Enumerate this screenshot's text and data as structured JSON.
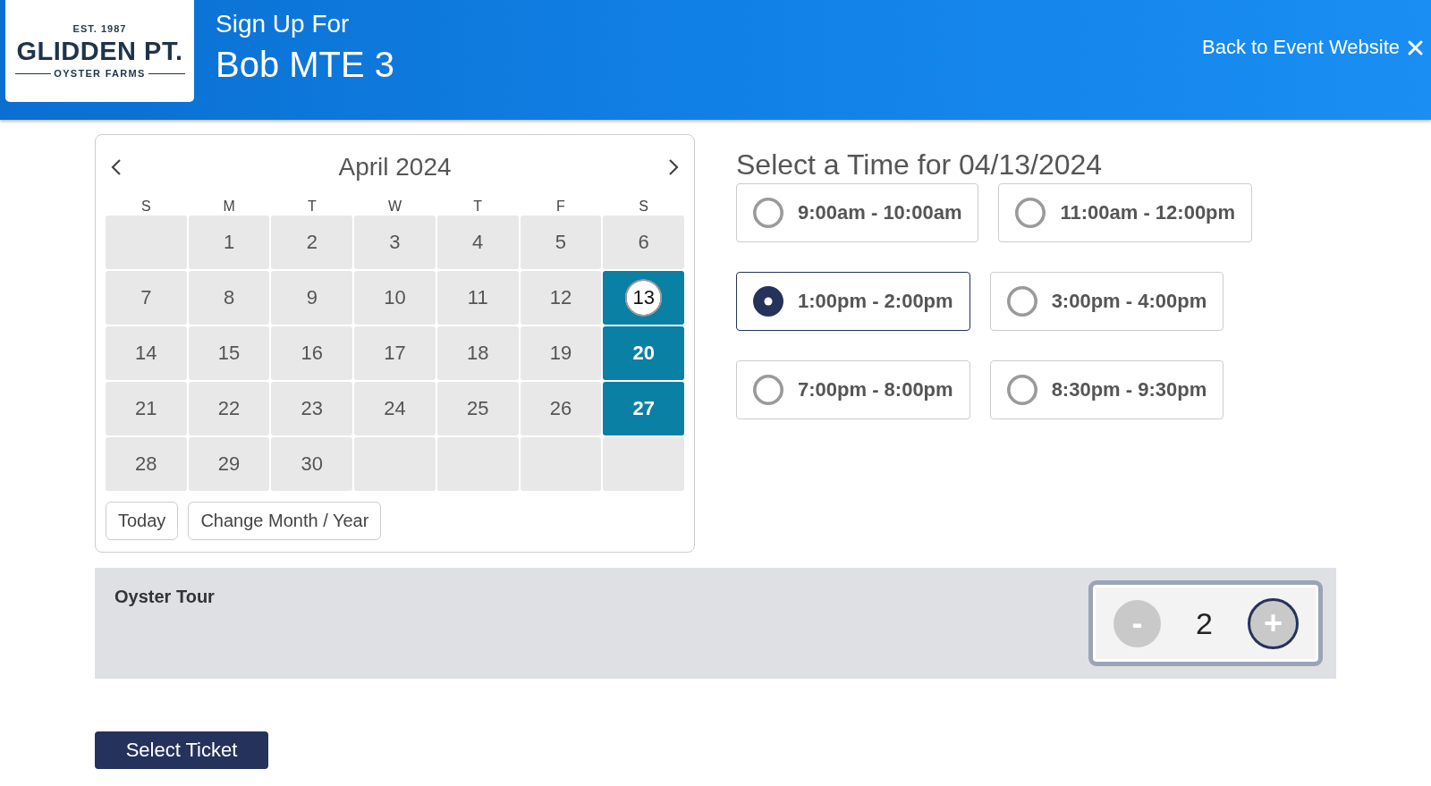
{
  "header": {
    "logo": {
      "established": "EST. 1987",
      "name": "GLIDDEN PT.",
      "tagline": "OYSTER FARMS"
    },
    "subtitle": "Sign Up For",
    "title": "Bob MTE 3",
    "back_link": "Back to Event Website"
  },
  "calendar": {
    "month": "April 2024",
    "weekdays": [
      "S",
      "M",
      "T",
      "W",
      "T",
      "F",
      "S"
    ],
    "weeks": [
      [
        {
          "kind": "empty"
        },
        {
          "kind": "day",
          "label": "1",
          "available": false,
          "selected": false
        },
        {
          "kind": "day",
          "label": "2",
          "available": false,
          "selected": false
        },
        {
          "kind": "day",
          "label": "3",
          "available": false,
          "selected": false
        },
        {
          "kind": "day",
          "label": "4",
          "available": false,
          "selected": false
        },
        {
          "kind": "day",
          "label": "5",
          "available": false,
          "selected": false
        },
        {
          "kind": "day",
          "label": "6",
          "available": false,
          "selected": false
        }
      ],
      [
        {
          "kind": "day",
          "label": "7",
          "available": false,
          "selected": false
        },
        {
          "kind": "day",
          "label": "8",
          "available": false,
          "selected": false
        },
        {
          "kind": "day",
          "label": "9",
          "available": false,
          "selected": false
        },
        {
          "kind": "day",
          "label": "10",
          "available": false,
          "selected": false
        },
        {
          "kind": "day",
          "label": "11",
          "available": false,
          "selected": false
        },
        {
          "kind": "day",
          "label": "12",
          "available": false,
          "selected": false
        },
        {
          "kind": "day",
          "label": "13",
          "available": true,
          "selected": true
        }
      ],
      [
        {
          "kind": "day",
          "label": "14",
          "available": false,
          "selected": false
        },
        {
          "kind": "day",
          "label": "15",
          "available": false,
          "selected": false
        },
        {
          "kind": "day",
          "label": "16",
          "available": false,
          "selected": false
        },
        {
          "kind": "day",
          "label": "17",
          "available": false,
          "selected": false
        },
        {
          "kind": "day",
          "label": "18",
          "available": false,
          "selected": false
        },
        {
          "kind": "day",
          "label": "19",
          "available": false,
          "selected": false
        },
        {
          "kind": "day",
          "label": "20",
          "available": true,
          "selected": false
        }
      ],
      [
        {
          "kind": "day",
          "label": "21",
          "available": false,
          "selected": false
        },
        {
          "kind": "day",
          "label": "22",
          "available": false,
          "selected": false
        },
        {
          "kind": "day",
          "label": "23",
          "available": false,
          "selected": false
        },
        {
          "kind": "day",
          "label": "24",
          "available": false,
          "selected": false
        },
        {
          "kind": "day",
          "label": "25",
          "available": false,
          "selected": false
        },
        {
          "kind": "day",
          "label": "26",
          "available": false,
          "selected": false
        },
        {
          "kind": "day",
          "label": "27",
          "available": true,
          "selected": false
        }
      ],
      [
        {
          "kind": "day",
          "label": "28",
          "available": false,
          "selected": false
        },
        {
          "kind": "day",
          "label": "29",
          "available": false,
          "selected": false
        },
        {
          "kind": "day",
          "label": "30",
          "available": false,
          "selected": false
        },
        {
          "kind": "empty"
        },
        {
          "kind": "empty"
        },
        {
          "kind": "empty"
        },
        {
          "kind": "empty"
        }
      ]
    ],
    "buttons": [
      "Today",
      "Change Month / Year"
    ]
  },
  "time_picker": {
    "title": "Select a Time for 04/13/2024",
    "slots": [
      {
        "label": "9:00am - 10:00am",
        "selected": false
      },
      {
        "label": "11:00am - 12:00pm",
        "selected": false
      },
      {
        "label": "1:00pm - 2:00pm",
        "selected": true
      },
      {
        "label": "3:00pm - 4:00pm",
        "selected": false
      },
      {
        "label": "7:00pm - 8:00pm",
        "selected": false
      },
      {
        "label": "8:30pm - 9:30pm",
        "selected": false
      }
    ]
  },
  "ticket": {
    "name": "Oyster Tour",
    "quantity": "2",
    "minus": {
      "label": "-",
      "focused": false
    },
    "plus": {
      "label": "+",
      "focused": true
    }
  },
  "submit_button": "Select Ticket"
}
